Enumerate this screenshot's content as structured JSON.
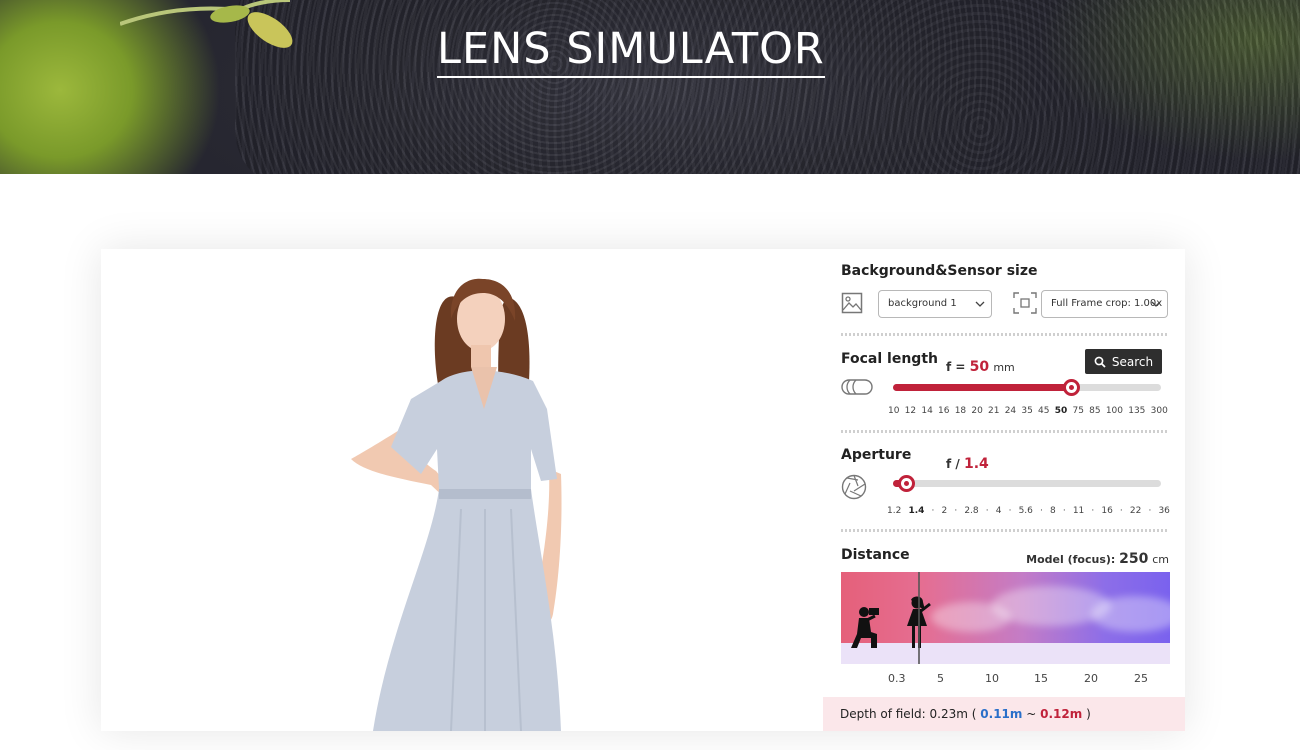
{
  "header": {
    "title": "LENS SIMULATOR"
  },
  "background_sensor": {
    "title": "Background&Sensor size",
    "background_select": "background 1",
    "sensor_select": "Full Frame crop: 1.00x"
  },
  "focal_length": {
    "title": "Focal length",
    "search_label": "Search",
    "prefix": "f =",
    "value": "50",
    "unit": "mm",
    "ticks": [
      "10",
      "12",
      "14",
      "16",
      "18",
      "20",
      "21",
      "24",
      "35",
      "45",
      "50",
      "75",
      "85",
      "100",
      "135",
      "300"
    ],
    "selected_tick": "50"
  },
  "aperture": {
    "title": "Aperture",
    "prefix": "f /",
    "value": "1.4",
    "ticks": [
      "1.2",
      "1.4",
      "·",
      "2",
      "·",
      "2.8",
      "·",
      "4",
      "·",
      "5.6",
      "·",
      "8",
      "·",
      "11",
      "·",
      "16",
      "·",
      "22",
      "·",
      "36"
    ],
    "selected_tick": "1.4"
  },
  "distance": {
    "title": "Distance",
    "model_label": "Model (focus):",
    "model_value": "250",
    "model_unit": "cm",
    "ticks": [
      "0.3",
      "5",
      "10",
      "15",
      "20",
      "25"
    ]
  },
  "depth_of_field": {
    "label": "Depth of field:",
    "total": "0.23m",
    "open": "(",
    "near": "0.11m",
    "sep": "~",
    "far": "0.12m",
    "close": ")"
  },
  "colors": {
    "accent": "#c0223a",
    "near": "#2a6fc9",
    "dof_bg": "#fbe7ea"
  }
}
